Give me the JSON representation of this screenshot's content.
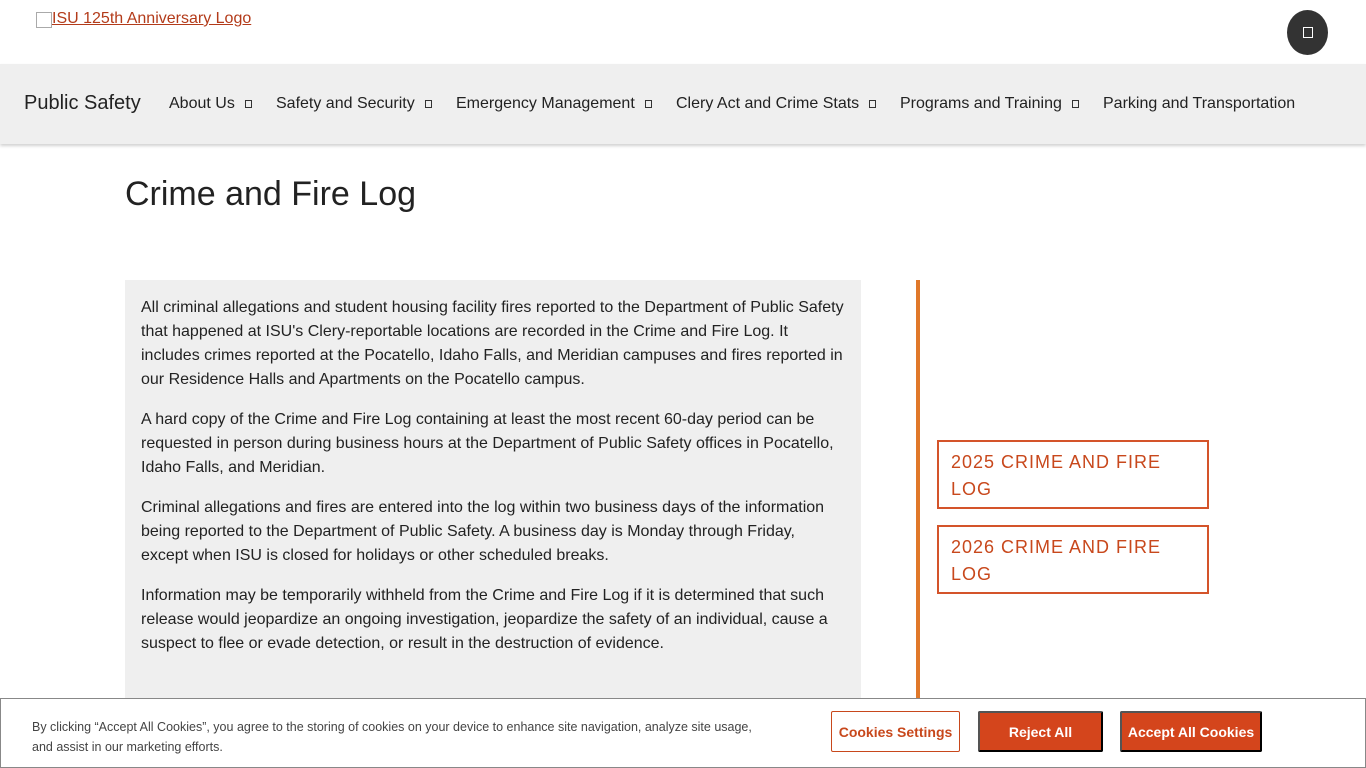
{
  "header": {
    "logo_alt": "ISU 125th Anniversary Logo"
  },
  "nav": {
    "brand": "Public Safety",
    "items": [
      {
        "label": "About Us"
      },
      {
        "label": "Safety and Security"
      },
      {
        "label": "Emergency Management"
      },
      {
        "label": "Clery Act and Crime Stats"
      },
      {
        "label": "Programs and Training"
      },
      {
        "label": "Parking and Transportation"
      }
    ]
  },
  "main": {
    "title": "Crime and Fire Log",
    "paragraphs": [
      "All criminal allegations and student housing facility fires reported to the Department of Public Safety that happened at ISU's Clery-reportable locations are recorded in the Crime and Fire Log. It includes crimes reported at the Pocatello, Idaho Falls, and Meridian campuses and fires reported in our Residence Halls and Apartments on the Pocatello campus.",
      "A hard copy of the Crime and Fire Log containing at least the most recent 60-day period can be requested in person during business hours at the Department of Public Safety offices in Pocatello, Idaho Falls, and Meridian.",
      "Criminal allegations and fires are entered into the log within two business days of the information being reported to the Department of Public Safety. A business day is Monday through Friday, except when ISU is closed for holidays or other scheduled breaks.",
      "Information may be temporarily withheld from the Crime and Fire Log if it is determined that such release would jeopardize an ongoing investigation, jeopardize the safety of an individual, cause a suspect to flee or evade detection, or result in the destruction of evidence."
    ]
  },
  "sidebar": {
    "links": [
      {
        "label": "2025 Crime and Fire Log"
      },
      {
        "label": "2026 Crime and Fire Log"
      }
    ]
  },
  "cookies": {
    "text": "By clicking “Accept All Cookies”, you agree to the storing of cookies on your device to enhance site navigation, analyze site usage, and assist in our marketing efforts.",
    "settings_label": "Cookies Settings",
    "reject_label": "Reject All",
    "accept_label": "Accept All Cookies"
  },
  "colors": {
    "accent": "#d4451c",
    "divider": "#e0782a",
    "panel": "#efefef"
  }
}
